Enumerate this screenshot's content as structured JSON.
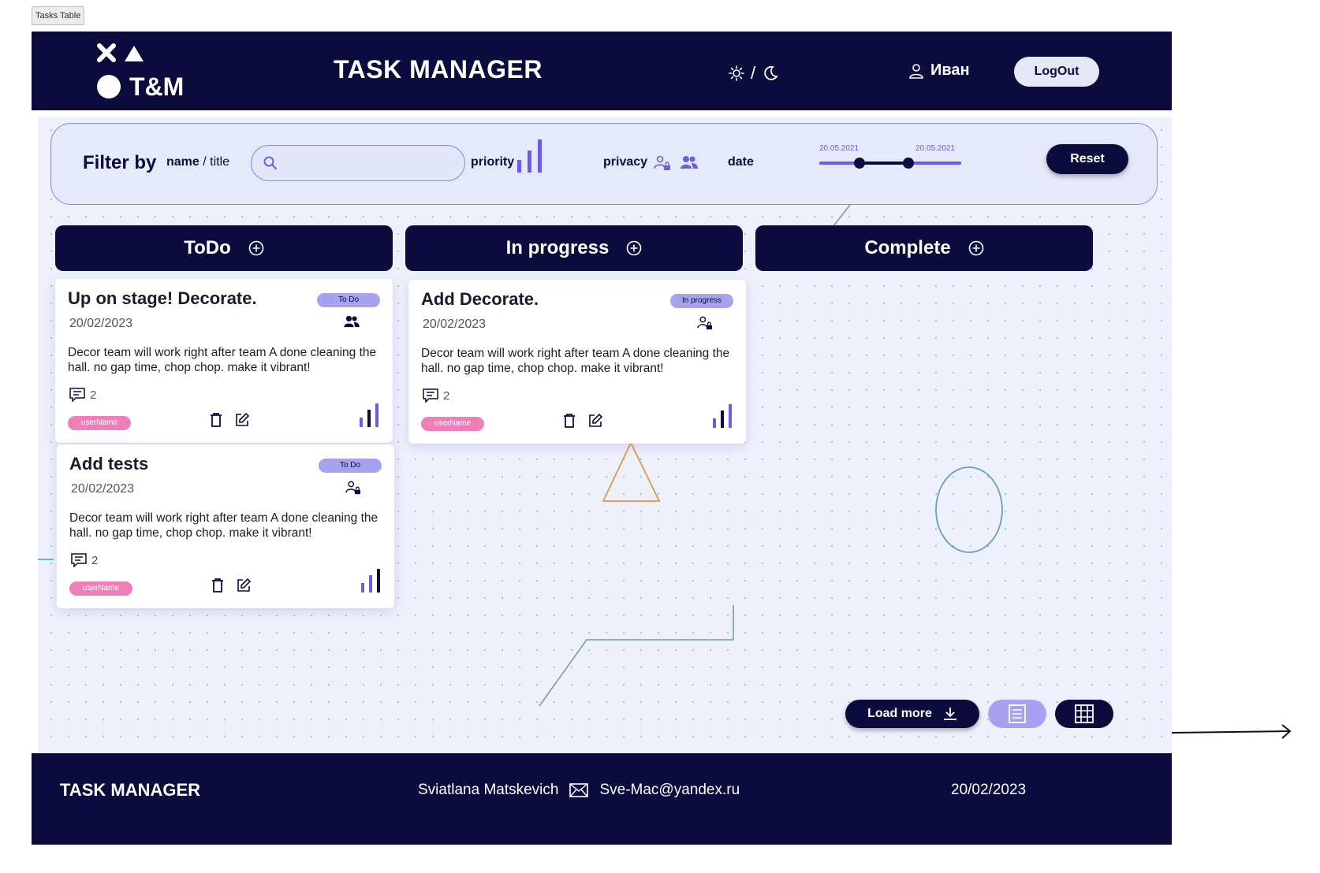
{
  "frame_label": "Tasks Table",
  "header": {
    "logo_text": "T&M",
    "title": "TASK MANAGER",
    "theme_separator": "/",
    "user_name": "Иван",
    "logout_label": "LogOut"
  },
  "filter": {
    "title": "Filter by",
    "name_label": "name",
    "title_label": "/ title",
    "search_value": "",
    "priority_label": "priority",
    "privacy_label": "privacy",
    "date_label": "date",
    "date_from": "20.05.2021",
    "date_to": "20.05.2021",
    "reset_label": "Reset"
  },
  "columns": [
    {
      "title": "ToDo"
    },
    {
      "title": "In progress"
    },
    {
      "title": "Complete"
    }
  ],
  "cards": [
    {
      "title": "Up on stage! Decorate.",
      "status": "To Do",
      "date": "20/02/2023",
      "description": "Decor team will work right after team A done cleaning the hall. no gap time, chop chop. make it vibrant!",
      "comments": "2",
      "owner": "userName",
      "privacy": "group-icon"
    },
    {
      "title": "Add tests",
      "status": "To Do",
      "date": "20/02/2023",
      "description": "Decor team will work right after team A done cleaning the hall. no gap time, chop chop. make it vibrant!",
      "comments": "2",
      "owner": "userName",
      "privacy": "private-user-icon"
    },
    {
      "title": "Add Decorate.",
      "status": "In progress",
      "date": "20/02/2023",
      "description": "Decor team will work right after team A done cleaning the hall. no gap time, chop chop. make it vibrant!",
      "comments": "2",
      "owner": "userName",
      "privacy": "private-user-icon"
    }
  ],
  "load_more_label": "Load more",
  "footer": {
    "title": "TASK MANAGER",
    "author": "Sviatlana Matskevich",
    "email": "Sve-Mac@yandex.ru",
    "date": "20/02/2023"
  },
  "colors": {
    "navy": "#0b0c3d",
    "accent": "#6c5ce7",
    "badge": "#a7a2f0",
    "owner_pill": "#ef7fb8"
  }
}
